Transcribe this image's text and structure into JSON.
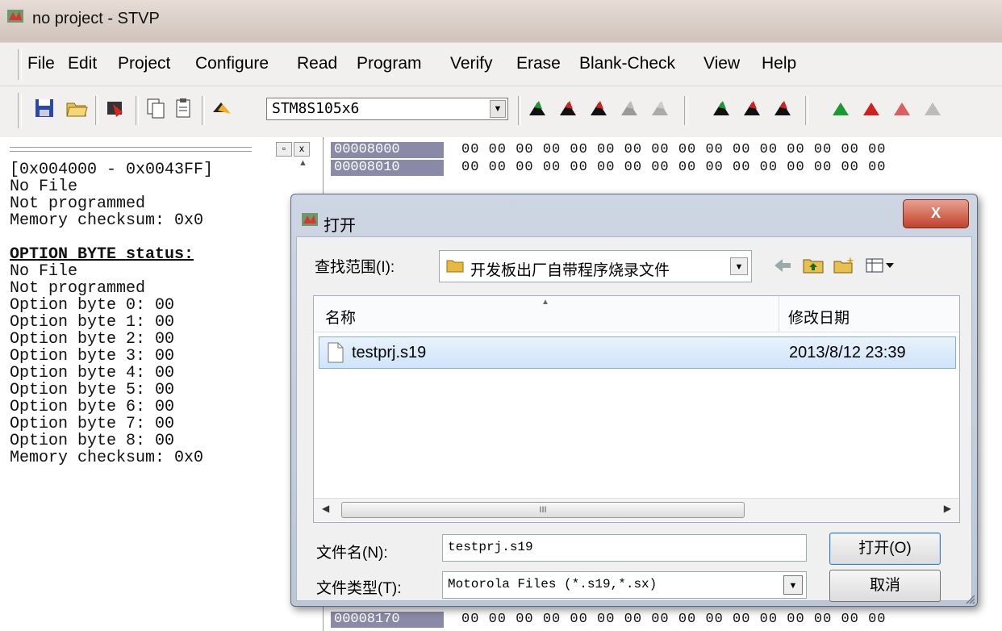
{
  "window": {
    "title": "no project - STVP",
    "icon": "stvp-app-icon"
  },
  "menu": {
    "items": [
      "File",
      "Edit",
      "Project",
      "Configure",
      "Read",
      "Program",
      "Verify",
      "Erase",
      "Blank-Check",
      "View",
      "Help"
    ]
  },
  "toolbar": {
    "device": "STM8S105x6",
    "icons": [
      "save-icon",
      "open-folder-icon",
      "chip-icon",
      "copy-icon",
      "paste-icon",
      "device-chip-icon"
    ],
    "read_icons": [
      "read-all-icon",
      "read-current-icon",
      "read-option-icon",
      "read-data-icon",
      "read-gray-icon"
    ],
    "program_icons": [
      "program-all-icon",
      "program-current-icon",
      "program-option-icon"
    ],
    "verify_icons": [
      "verify-all-icon",
      "verify-current-icon",
      "verify-option-icon",
      "verify-gray-icon"
    ]
  },
  "left_panel": {
    "lines": [
      "[0x004000 - 0x0043FF]",
      "No File",
      "Not programmed",
      "Memory checksum: 0x0",
      "",
      "OPTION BYTE status:",
      "No File",
      "Not programmed",
      "Option byte 0: 00",
      "Option byte 1: 00",
      "Option byte 2: 00",
      "Option byte 3: 00",
      "Option byte 4: 00",
      "Option byte 5: 00",
      "Option byte 6: 00",
      "Option byte 7: 00",
      "Option byte 8: 00",
      "Memory checksum: 0x0"
    ]
  },
  "hex": {
    "rows": [
      {
        "addr": "00008000",
        "bytes": "00 00 00 00 00 00 00 00 00 00 00 00 00 00 00 00"
      },
      {
        "addr": "00008010",
        "bytes": "00 00 00 00 00 00 00 00 00 00 00 00 00 00 00 00"
      },
      {
        "addr": "00008170",
        "bytes": "00 00 00 00 00 00 00 00 00 00 00 00 00 00 00 00"
      }
    ]
  },
  "dialog": {
    "title": "打开",
    "close": "X",
    "look_in_label": "查找范围(I):",
    "look_in_value": "开发板出厂自带程序烧录文件",
    "col_name": "名称",
    "col_date": "修改日期",
    "file": {
      "name": "testprj.s19",
      "date": "2013/8/12 23:39"
    },
    "scroll_grip": "III",
    "filename_label": "文件名(N):",
    "filename_value": "testprj.s19",
    "filetype_label": "文件类型(T):",
    "filetype_value": "Motorola Files (*.s19,*.sx)",
    "open_button": "打开(O)",
    "cancel_button": "取消"
  }
}
